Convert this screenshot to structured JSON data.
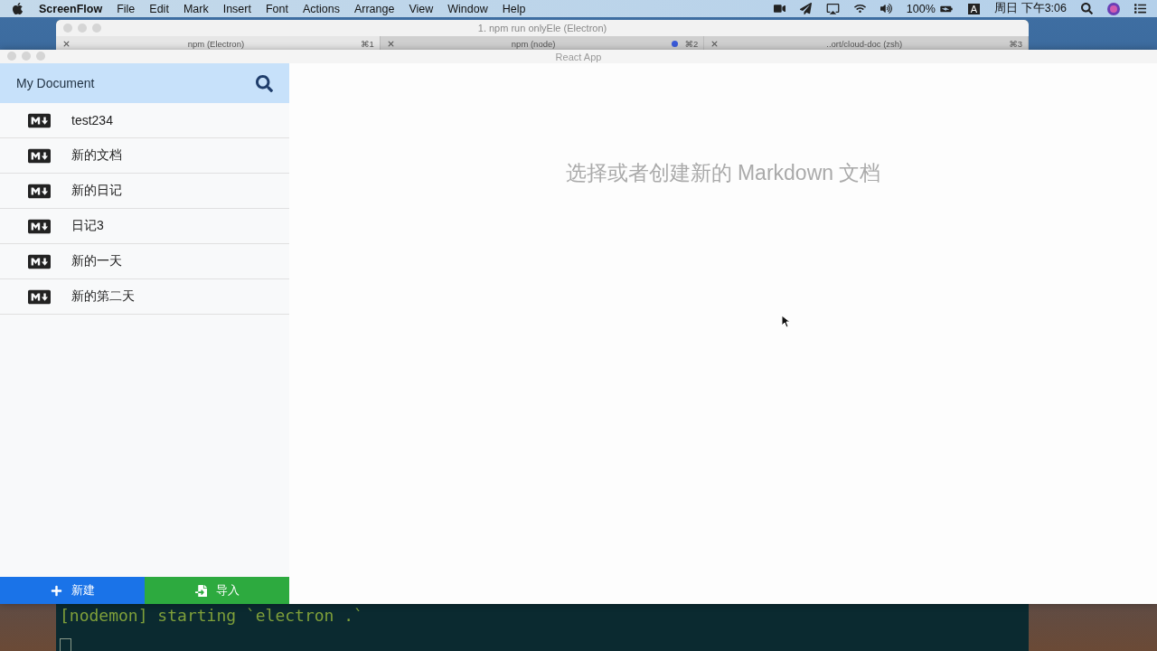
{
  "menu_bar": {
    "app_name": "ScreenFlow",
    "menus": [
      "File",
      "Edit",
      "Mark",
      "Insert",
      "Font",
      "Actions",
      "Arrange",
      "View",
      "Window",
      "Help"
    ],
    "battery": "100%",
    "input_source": "A",
    "clock": "周日 下午3:06"
  },
  "terminal": {
    "title": "1. npm run onlyEle (Electron)",
    "tabs": [
      {
        "label": "npm (Electron)",
        "shortcut": "⌘1",
        "selected": true,
        "activity": false
      },
      {
        "label": "npm (node)",
        "shortcut": "⌘2",
        "selected": false,
        "activity": true
      },
      {
        "label": "..ort/cloud-doc (zsh)",
        "shortcut": "⌘3",
        "selected": false,
        "activity": false
      }
    ],
    "output": "[nodemon] starting `electron .`"
  },
  "app": {
    "title": "React App",
    "sidebar": {
      "title": "My Document",
      "files": [
        {
          "name": "test234"
        },
        {
          "name": "新的文档"
        },
        {
          "name": "新的日记"
        },
        {
          "name": "日记3"
        },
        {
          "name": "新的一天"
        },
        {
          "name": "新的第二天"
        }
      ],
      "buttons": [
        {
          "kind": "new",
          "label": "新建"
        },
        {
          "kind": "import",
          "label": "导入"
        }
      ]
    },
    "empty_message": "选择或者创建新的 Markdown 文档"
  }
}
